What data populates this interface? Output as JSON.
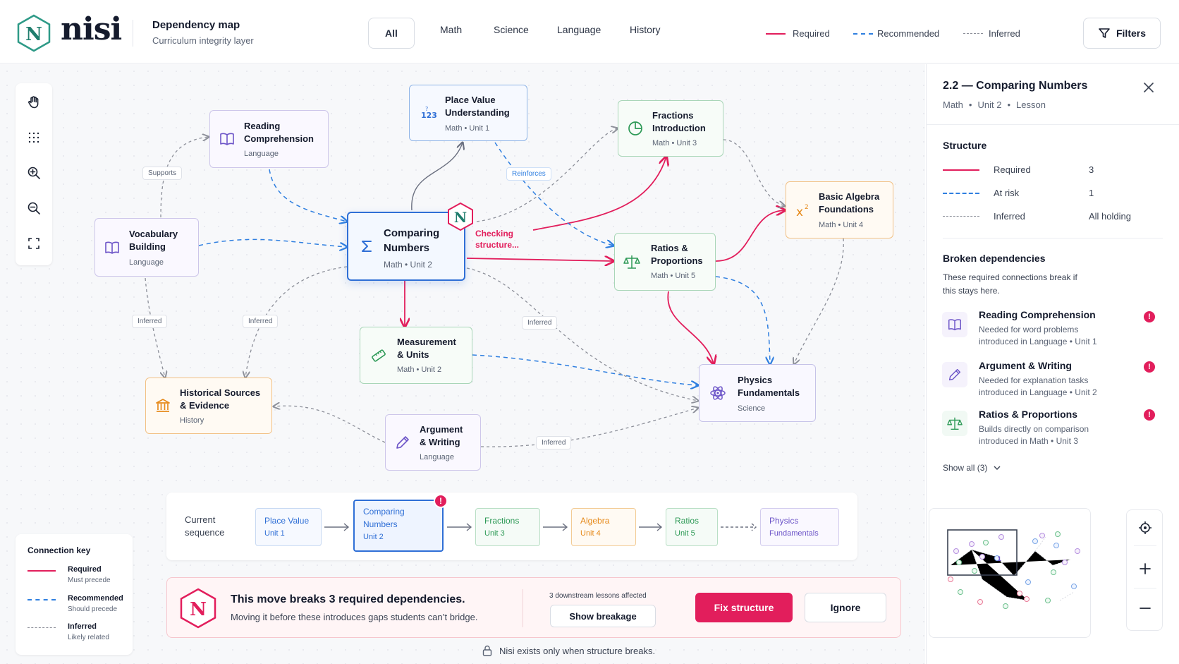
{
  "brand": {
    "name": "nisi",
    "logo_letter": "N"
  },
  "header": {
    "title": "Dependency map",
    "subtitle": "Curriculum integrity layer",
    "tabs": [
      "All",
      "Math",
      "Science",
      "Language",
      "History"
    ],
    "legend": {
      "required": "Required",
      "recommended": "Recommended",
      "inferred": "Inferred"
    },
    "filters_label": "Filters"
  },
  "colors": {
    "required": "#e21e5c",
    "recommended": "#2f7fe0",
    "inferred": "#8c8f99",
    "math": "#2f6fd6",
    "science": "#6d55c8",
    "language": "#6d55c8",
    "green": "#2e9a57",
    "orange": "#e68a1b"
  },
  "nodes": {
    "place_value": {
      "title1": "Place Value",
      "title2": "Understanding",
      "sub": "Math • Unit 1",
      "icon": "123-icon"
    },
    "reading": {
      "title1": "Reading",
      "title2": "Comprehension",
      "sub": "Language",
      "icon": "book-icon"
    },
    "fractions": {
      "title1": "Fractions",
      "title2": "Introduction",
      "sub": "Math • Unit 3",
      "icon": "pie-icon"
    },
    "algebra": {
      "title1": "Basic Algebra",
      "title2": "Foundations",
      "sub": "Math • Unit 4",
      "icon": "x-squared-icon"
    },
    "vocab": {
      "title1": "Vocabulary",
      "title2": "Building",
      "sub": "Language",
      "icon": "book-icon"
    },
    "comparing": {
      "title1": "Comparing",
      "title2": "Numbers",
      "sub": "Math • Unit 2",
      "icon": "sigma-icon"
    },
    "ratios": {
      "title1": "Ratios &",
      "title2": "Proportions",
      "sub": "Math • Unit 5",
      "icon": "scale-icon"
    },
    "measurement": {
      "title1": "Measurement",
      "title2": "& Units",
      "sub": "Math • Unit 2",
      "icon": "ruler-icon"
    },
    "physics": {
      "title1": "Physics",
      "title2": "Fundamentals",
      "sub": "Science",
      "icon": "atom-icon"
    },
    "historical": {
      "title1": "Historical Sources",
      "title2": "& Evidence",
      "sub": "History",
      "icon": "museum-icon"
    },
    "argument": {
      "title1": "Argument",
      "title2": "& Writing",
      "sub": "Language",
      "icon": "pencil-icon"
    }
  },
  "edge_labels": {
    "supports": "Supports",
    "reinforces": "Reinforces",
    "inferred": "Inferred"
  },
  "checking": {
    "line1": "Checking",
    "line2": "structure..."
  },
  "sequence": {
    "label1": "Current",
    "label2": "sequence",
    "items": [
      {
        "title": "Place Value",
        "sub": "Unit 1"
      },
      {
        "title1": "Comparing",
        "title2": "Numbers",
        "sub": "Unit 2"
      },
      {
        "title": "Fractions",
        "sub": "Unit 3"
      },
      {
        "title": "Algebra",
        "sub": "Unit 4"
      },
      {
        "title": "Ratios",
        "sub": "Unit 5"
      },
      {
        "title1": "Physics",
        "title2": "Fundamentals"
      }
    ],
    "badge": "!"
  },
  "alert": {
    "title": "This move breaks 3 required dependencies.",
    "body": "Moving it before these introduces gaps students can’t bridge.",
    "affected": "3 downstream lessons affected",
    "show_breakage": "Show breakage",
    "fix": "Fix structure",
    "ignore": "Ignore"
  },
  "footer_note": "Nisi exists only when structure breaks.",
  "key": {
    "title": "Connection key",
    "items": [
      {
        "t": "Required",
        "s": "Must precede"
      },
      {
        "t": "Recommended",
        "s": "Should precede"
      },
      {
        "t": "Inferred",
        "s": "Likely related"
      }
    ]
  },
  "panel": {
    "title": "2.2 — Comparing Numbers",
    "meta": [
      "Math",
      "Unit 2",
      "Lesson"
    ],
    "structure_title": "Structure",
    "structure": [
      {
        "label": "Required",
        "value": "3"
      },
      {
        "label": "At risk",
        "value": "1"
      },
      {
        "label": "Inferred",
        "value": "All holding"
      }
    ],
    "broken_title": "Broken dependencies",
    "broken_desc1": "These required connections break if",
    "broken_desc2": "this stays here.",
    "broken": [
      {
        "title": "Reading Comprehension",
        "l1": "Needed for word problems",
        "l2": "introduced in Language • Unit 1",
        "icon": "book-icon"
      },
      {
        "title": "Argument & Writing",
        "l1": "Needed for explanation tasks",
        "l2": "introduced in Language • Unit 2",
        "icon": "pencil-icon"
      },
      {
        "title": "Ratios & Proportions",
        "l1": "Builds directly on comparison",
        "l2": "introduced in Math • Unit 3",
        "icon": "scale-icon"
      }
    ],
    "show_all": "Show all (3)"
  },
  "minimap": {
    "marker": "1"
  }
}
